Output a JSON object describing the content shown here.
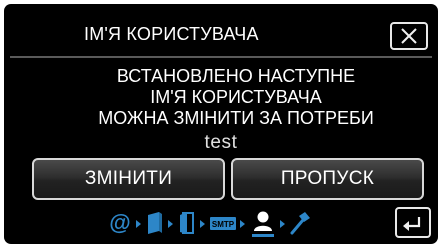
{
  "dialog": {
    "title": "ІМ'Я КОРИСТУВАЧА",
    "message_lines": [
      "ВСТАНОВЛЕНО НАСТУПНЕ",
      "ІМ'Я КОРИСТУВАЧА",
      "МОЖНА ЗМІНИТИ ЗА ПОТРЕБИ"
    ],
    "username_value": "test",
    "close_icon": "close-icon"
  },
  "buttons": {
    "change_label": "ЗМІНИТИ",
    "skip_label": "ПРОПУСК"
  },
  "steps": {
    "items": [
      {
        "icon": "at-sign-icon",
        "active": false
      },
      {
        "icon": "book-icon",
        "active": false
      },
      {
        "icon": "door-icon",
        "active": false
      },
      {
        "icon": "smtp-icon",
        "label": "SMTP",
        "active": false
      },
      {
        "icon": "user-icon",
        "active": true
      },
      {
        "icon": "hammer-icon",
        "active": false
      }
    ],
    "inactive_color": "#2d86c8",
    "active_color": "#ffffff"
  },
  "footer": {
    "back_icon": "return-arrow-icon"
  }
}
